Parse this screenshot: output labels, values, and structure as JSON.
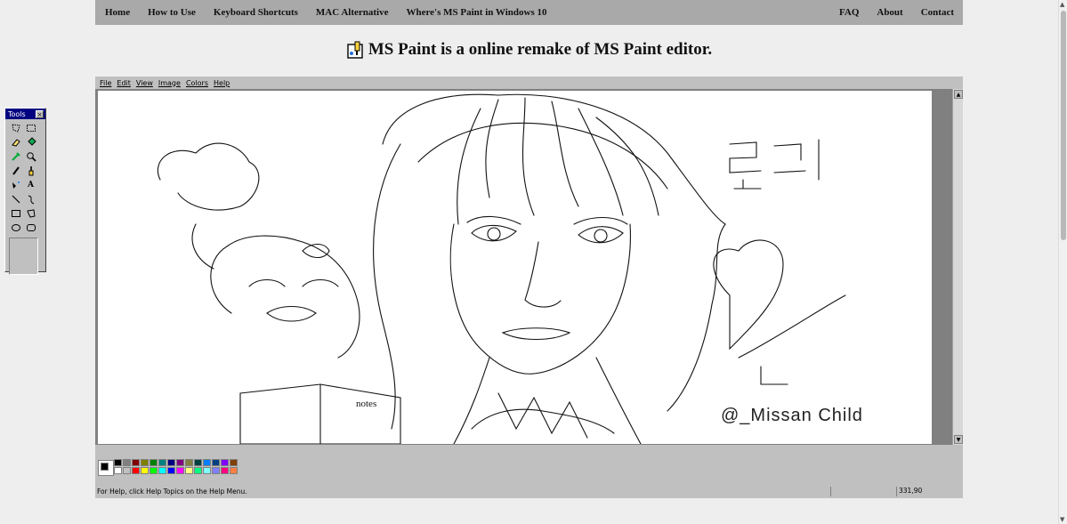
{
  "nav": {
    "left": [
      {
        "label": "Home"
      },
      {
        "label": "How to Use"
      },
      {
        "label": "Keyboard Shortcuts"
      },
      {
        "label": "MAC Alternative"
      },
      {
        "label": "Where's MS Paint in Windows 10"
      }
    ],
    "right": [
      {
        "label": "FAQ"
      },
      {
        "label": "About"
      },
      {
        "label": "Contact"
      }
    ]
  },
  "headline": "MS Paint is a online remake of MS Paint editor.",
  "paint": {
    "menu": [
      "File",
      "Edit",
      "View",
      "Image",
      "Colors",
      "Help"
    ],
    "toolbox_title": "Tools",
    "toolbox_close": "×",
    "tools": [
      {
        "name": "free-select",
        "glyph": ""
      },
      {
        "name": "rect-select",
        "glyph": ""
      },
      {
        "name": "eraser",
        "glyph": ""
      },
      {
        "name": "fill-bucket",
        "glyph": ""
      },
      {
        "name": "color-picker",
        "glyph": ""
      },
      {
        "name": "magnifier",
        "glyph": ""
      },
      {
        "name": "pencil",
        "glyph": ""
      },
      {
        "name": "brush",
        "glyph": ""
      },
      {
        "name": "airbrush",
        "glyph": ""
      },
      {
        "name": "text",
        "glyph": "A"
      },
      {
        "name": "line",
        "glyph": ""
      },
      {
        "name": "curve",
        "glyph": ""
      },
      {
        "name": "rectangle",
        "glyph": ""
      },
      {
        "name": "polygon",
        "glyph": ""
      },
      {
        "name": "ellipse",
        "glyph": ""
      },
      {
        "name": "rounded-rectangle",
        "glyph": ""
      }
    ],
    "colors": {
      "primary": "#000000",
      "secondary": "#ffffff",
      "palette_top": [
        "#000000",
        "#808080",
        "#800000",
        "#808000",
        "#008000",
        "#008080",
        "#000080",
        "#800080",
        "#808040",
        "#004040",
        "#0080ff",
        "#004080",
        "#8000ff",
        "#804000"
      ],
      "palette_bottom": [
        "#ffffff",
        "#c0c0c0",
        "#ff0000",
        "#ffff00",
        "#00ff00",
        "#00ffff",
        "#0000ff",
        "#ff00ff",
        "#ffff80",
        "#00ff80",
        "#80ffff",
        "#8080ff",
        "#ff0080",
        "#ff8040"
      ]
    },
    "status_text": "For Help, click Help Topics on the Help Menu.",
    "coords": "331,90",
    "art": {
      "korean_text": "릴리",
      "signature": "@_Missan Child"
    }
  }
}
